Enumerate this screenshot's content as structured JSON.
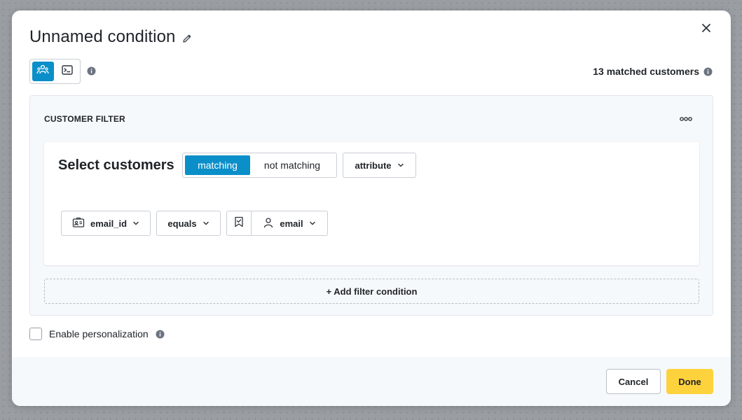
{
  "modal": {
    "title": "Unnamed condition",
    "matched_customers": "13 matched customers"
  },
  "filter": {
    "header": "CUSTOMER FILTER",
    "select_title": "Select customers",
    "segments": [
      "matching",
      "not matching"
    ],
    "selected_segment": "matching",
    "scope_dropdown": "attribute",
    "rule": {
      "field": "email_id",
      "operator": "equals",
      "value": "email"
    },
    "add_condition": "+ Add filter condition"
  },
  "personalization": {
    "label": "Enable personalization",
    "checked": false
  },
  "footer": {
    "cancel": "Cancel",
    "done": "Done"
  },
  "colors": {
    "accent": "#0b8fc9",
    "primary_button": "#fdd23c",
    "panel_bg": "#f6f9fc"
  }
}
